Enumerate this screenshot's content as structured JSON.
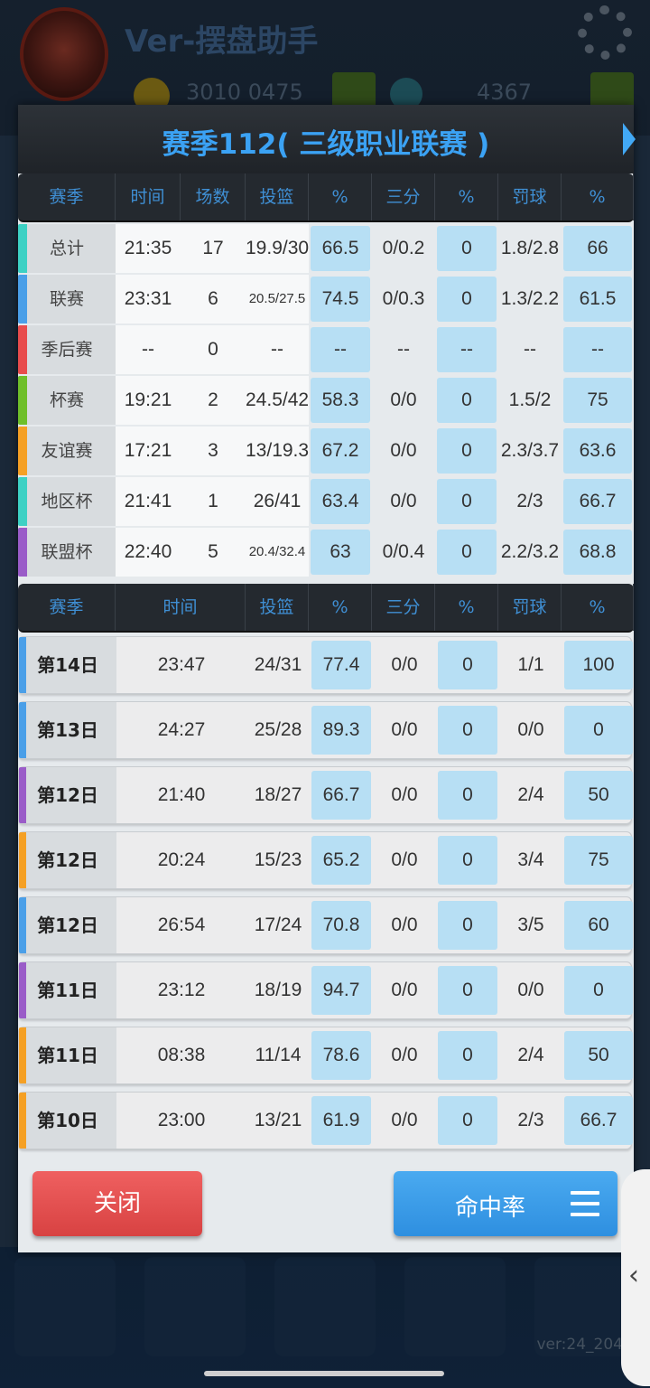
{
  "background": {
    "app_title": "Ver-摆盘助手",
    "coins": "3010 0475",
    "gems": "4367",
    "version": "ver:24_204"
  },
  "dialog": {
    "title": "赛季112( 三级职业联赛 )",
    "season_table": {
      "headers": [
        "赛季",
        "时间",
        "场数",
        "投篮",
        "%",
        "三分",
        "%",
        "罚球",
        "%"
      ],
      "rows": [
        {
          "cat": "总计",
          "color": "#3dd1c4",
          "time": "21:35",
          "games": "17",
          "fg": "19.9/30",
          "fg_pct": "66.5",
          "three": "0/0.2",
          "three_pct": "0",
          "ft": "1.8/2.8",
          "ft_pct": "66"
        },
        {
          "cat": "联赛",
          "color": "#4a9fe8",
          "time": "23:31",
          "games": "6",
          "fg": "20.5/27.5",
          "fg_pct": "74.5",
          "three": "0/0.3",
          "three_pct": "0",
          "ft": "1.3/2.2",
          "ft_pct": "61.5"
        },
        {
          "cat": "季后赛",
          "color": "#e84c4c",
          "time": "--",
          "games": "0",
          "fg": "--",
          "fg_pct": "--",
          "three": "--",
          "three_pct": "--",
          "ft": "--",
          "ft_pct": "--"
        },
        {
          "cat": "杯赛",
          "color": "#6fbf2a",
          "time": "19:21",
          "games": "2",
          "fg": "24.5/42",
          "fg_pct": "58.3",
          "three": "0/0",
          "three_pct": "0",
          "ft": "1.5/2",
          "ft_pct": "75"
        },
        {
          "cat": "友谊赛",
          "color": "#f5a024",
          "time": "17:21",
          "games": "3",
          "fg": "13/19.3",
          "fg_pct": "67.2",
          "three": "0/0",
          "three_pct": "0",
          "ft": "2.3/3.7",
          "ft_pct": "63.6"
        },
        {
          "cat": "地区杯",
          "color": "#3dd1c4",
          "time": "21:41",
          "games": "1",
          "fg": "26/41",
          "fg_pct": "63.4",
          "three": "0/0",
          "three_pct": "0",
          "ft": "2/3",
          "ft_pct": "66.7"
        },
        {
          "cat": "联盟杯",
          "color": "#9a5cc8",
          "time": "22:40",
          "games": "5",
          "fg": "20.4/32.4",
          "fg_pct": "63",
          "three": "0/0.4",
          "three_pct": "0",
          "ft": "2.2/3.2",
          "ft_pct": "68.8"
        }
      ]
    },
    "game_table": {
      "headers": [
        "赛季",
        "时间",
        "投篮",
        "%",
        "三分",
        "%",
        "罚球",
        "%"
      ],
      "rows": [
        {
          "day": "第14日",
          "color": "#4a9fe8",
          "time": "23:47",
          "fg": "24/31",
          "fg_pct": "77.4",
          "three": "0/0",
          "three_pct": "0",
          "ft": "1/1",
          "ft_pct": "100"
        },
        {
          "day": "第13日",
          "color": "#4a9fe8",
          "time": "24:27",
          "fg": "25/28",
          "fg_pct": "89.3",
          "three": "0/0",
          "three_pct": "0",
          "ft": "0/0",
          "ft_pct": "0"
        },
        {
          "day": "第12日",
          "color": "#9a5cc8",
          "time": "21:40",
          "fg": "18/27",
          "fg_pct": "66.7",
          "three": "0/0",
          "three_pct": "0",
          "ft": "2/4",
          "ft_pct": "50"
        },
        {
          "day": "第12日",
          "color": "#f5a024",
          "time": "20:24",
          "fg": "15/23",
          "fg_pct": "65.2",
          "three": "0/0",
          "three_pct": "0",
          "ft": "3/4",
          "ft_pct": "75"
        },
        {
          "day": "第12日",
          "color": "#4a9fe8",
          "time": "26:54",
          "fg": "17/24",
          "fg_pct": "70.8",
          "three": "0/0",
          "three_pct": "0",
          "ft": "3/5",
          "ft_pct": "60"
        },
        {
          "day": "第11日",
          "color": "#9a5cc8",
          "time": "23:12",
          "fg": "18/19",
          "fg_pct": "94.7",
          "three": "0/0",
          "three_pct": "0",
          "ft": "0/0",
          "ft_pct": "0"
        },
        {
          "day": "第11日",
          "color": "#f5a024",
          "time": "08:38",
          "fg": "11/14",
          "fg_pct": "78.6",
          "three": "0/0",
          "three_pct": "0",
          "ft": "2/4",
          "ft_pct": "50"
        },
        {
          "day": "第10日",
          "color": "#f5a024",
          "time": "23:00",
          "fg": "13/21",
          "fg_pct": "61.9",
          "three": "0/0",
          "three_pct": "0",
          "ft": "2/3",
          "ft_pct": "66.7"
        }
      ]
    },
    "buttons": {
      "close": "关闭",
      "hit_rate": "命中率"
    }
  },
  "side_tab": {
    "icon": "chevron-left-icon",
    "glyph": "‹"
  }
}
